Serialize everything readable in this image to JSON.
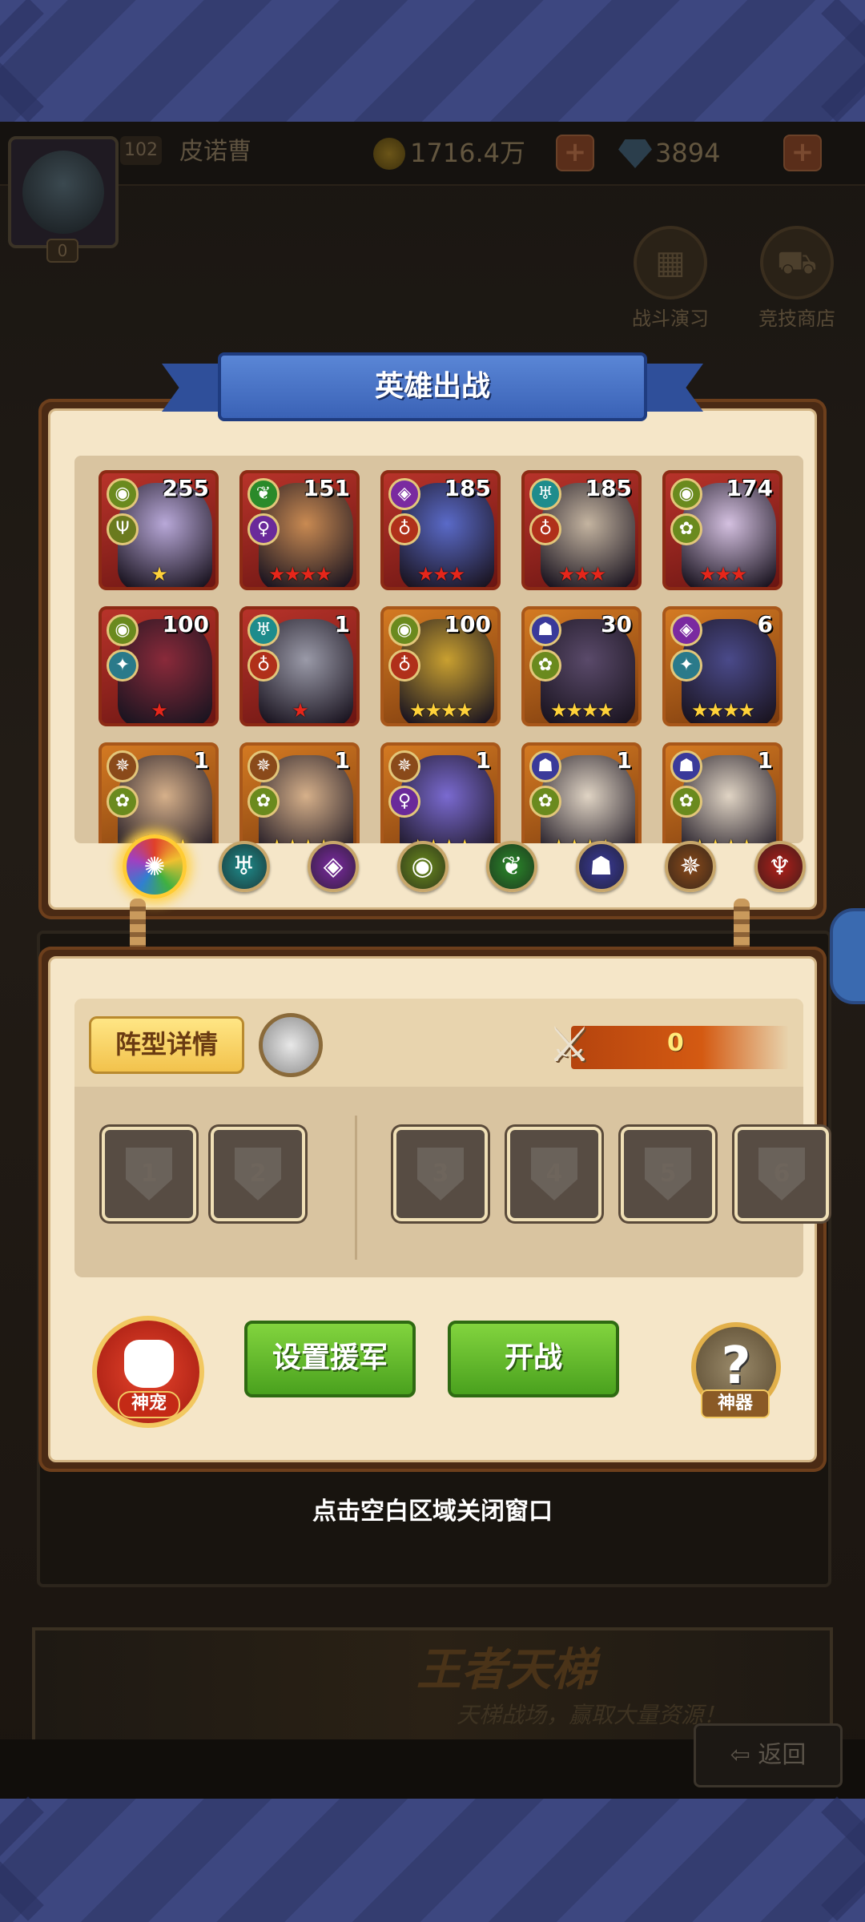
{
  "top_bar": {
    "level": "102",
    "player_name": "皮诺曹",
    "gold": "1716.4万",
    "gems": "3894",
    "vip": "0"
  },
  "scene_buttons": [
    {
      "label": "战斗演习",
      "icon": "film-icon"
    },
    {
      "label": "竞技商店",
      "icon": "cart-icon"
    }
  ],
  "ladder": {
    "title": "王者天梯",
    "subtitle": "天梯战场，赢取大量资源！"
  },
  "return_label": "返回",
  "modal": {
    "title": "英雄出战",
    "heroes": [
      {
        "level": "255",
        "faction_icon": "light-eye",
        "class_icon": "trident",
        "stars": "★",
        "star_color": "#ffd23a",
        "border": "red"
      },
      {
        "level": "151",
        "faction_icon": "forest-leaf",
        "class_icon": "mage-orb",
        "stars": "★★★★",
        "star_color": "#e6261a",
        "border": "red"
      },
      {
        "level": "185",
        "faction_icon": "shadow-orb",
        "class_icon": "warrior-flame",
        "stars": "★★★",
        "star_color": "#e6261a",
        "border": "red"
      },
      {
        "level": "185",
        "faction_icon": "abyss-wing",
        "class_icon": "warrior-flame",
        "stars": "★★★",
        "star_color": "#e6261a",
        "border": "red"
      },
      {
        "level": "174",
        "faction_icon": "light-eye",
        "class_icon": "support-orb",
        "stars": "★★★",
        "star_color": "#e6261a",
        "border": "red"
      },
      {
        "level": "100",
        "faction_icon": "light-eye",
        "class_icon": "shuriken",
        "stars": "★",
        "star_color": "#e6261a",
        "border": "red"
      },
      {
        "level": "1",
        "faction_icon": "abyss-wing",
        "class_icon": "warrior-flame",
        "stars": "★",
        "star_color": "#e6261a",
        "border": "red"
      },
      {
        "level": "100",
        "faction_icon": "light-eye",
        "class_icon": "warrior-flame",
        "stars": "★★★★",
        "star_color": "#ffd23a",
        "border": "orange"
      },
      {
        "level": "30",
        "faction_icon": "dark-skull",
        "class_icon": "support-orb",
        "stars": "★★★★",
        "star_color": "#ffd23a",
        "border": "orange"
      },
      {
        "level": "6",
        "faction_icon": "shadow-orb",
        "class_icon": "shuriken",
        "stars": "★★★★",
        "star_color": "#ffd23a",
        "border": "orange"
      },
      {
        "level": "1",
        "faction_icon": "heaven-wheel",
        "class_icon": "support-orb",
        "stars": "★★★★",
        "star_color": "#ffd23a",
        "border": "orange"
      },
      {
        "level": "1",
        "faction_icon": "heaven-wheel",
        "class_icon": "support-orb",
        "stars": "★★★★",
        "star_color": "#ffd23a",
        "border": "orange"
      },
      {
        "level": "1",
        "faction_icon": "heaven-wheel",
        "class_icon": "mage-orb",
        "stars": "★★★★",
        "star_color": "#ffd23a",
        "border": "orange"
      },
      {
        "level": "1",
        "faction_icon": "dark-skull",
        "class_icon": "support-orb",
        "stars": "★★★★",
        "star_color": "#ffd23a",
        "border": "orange"
      },
      {
        "level": "1",
        "faction_icon": "dark-skull",
        "class_icon": "support-orb",
        "stars": "★★★★",
        "star_color": "#ffd23a",
        "border": "orange"
      }
    ],
    "faction_filters": [
      {
        "name": "all",
        "icon": "rainbow-swirl-icon",
        "color": "#e05a2a",
        "active": true
      },
      {
        "name": "abyss",
        "icon": "wing-icon",
        "color": "#1e8c8c"
      },
      {
        "name": "shadow",
        "icon": "orb-icon",
        "color": "#7a2aa0"
      },
      {
        "name": "light",
        "icon": "eye-icon",
        "color": "#6a8a1e"
      },
      {
        "name": "forest",
        "icon": "leaf-icon",
        "color": "#2a8a2a"
      },
      {
        "name": "dark",
        "icon": "skull-icon",
        "color": "#3a3a9a"
      },
      {
        "name": "heaven",
        "icon": "wheel-icon",
        "color": "#8a4a1a"
      },
      {
        "name": "fortress",
        "icon": "crest-icon",
        "color": "#b0201a"
      }
    ]
  },
  "formation": {
    "details_label": "阵型详情",
    "power_value": "0",
    "slots": [
      "1",
      "2",
      "3",
      "4",
      "5",
      "6"
    ],
    "reinforce_label": "设置援军",
    "start_label": "开战",
    "pet_label": "神宠",
    "artifact_label": "神器",
    "artifact_symbol": "?"
  },
  "close_hint": "点击空白区域关闭窗口"
}
